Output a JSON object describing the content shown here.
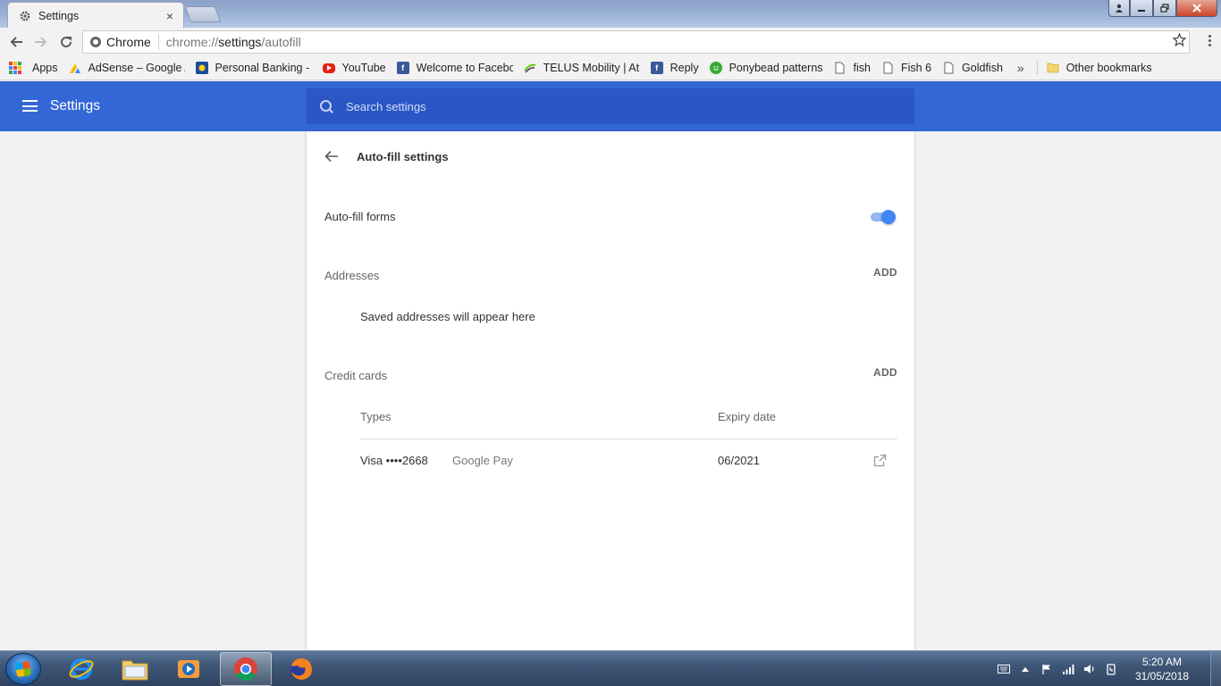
{
  "window": {
    "tab_title": "Settings",
    "tab_close": "×"
  },
  "toolbar": {
    "omnibox_chip": "Chrome",
    "url_scheme": "chrome://",
    "url_host": "settings",
    "url_path": "/autofill"
  },
  "bookmarks": [
    {
      "label": "Apps",
      "icon": "apps-grid-icon"
    },
    {
      "label": "AdSense – Google A",
      "icon": "adsense-icon"
    },
    {
      "label": "Personal Banking - A",
      "icon": "bank-icon"
    },
    {
      "label": "YouTube",
      "icon": "youtube-icon"
    },
    {
      "label": "Welcome to Facebo",
      "icon": "facebook-icon"
    },
    {
      "label": "TELUS Mobility | At T",
      "icon": "telus-icon"
    },
    {
      "label": "Reply",
      "icon": "facebook-icon"
    },
    {
      "label": "Ponybead patterns",
      "icon": "smiley-icon"
    },
    {
      "label": "fish",
      "icon": "page-icon"
    },
    {
      "label": "Fish 6",
      "icon": "page-icon"
    },
    {
      "label": "Goldfish",
      "icon": "page-icon"
    }
  ],
  "bookmarks_more": "»",
  "other_bookmarks": "Other bookmarks",
  "settings": {
    "title": "Settings",
    "search_placeholder": "Search settings"
  },
  "autofill": {
    "subpage_title": "Auto-fill settings",
    "forms_label": "Auto-fill forms",
    "forms_enabled": true,
    "addresses": {
      "label": "Addresses",
      "add": "ADD",
      "empty": "Saved addresses will appear here"
    },
    "cards": {
      "label": "Credit cards",
      "add": "ADD",
      "col_types": "Types",
      "col_expiry": "Expiry date",
      "rows": [
        {
          "card": "Visa ••••2668",
          "source": "Google Pay",
          "expiry": "06/2021"
        }
      ]
    }
  },
  "taskbar": {
    "time": "5:20 AM",
    "date": "31/05/2018"
  },
  "colors": {
    "header_blue": "#3367d6",
    "search_blue": "#2a56c6",
    "toggle_on": "#4285f4"
  }
}
